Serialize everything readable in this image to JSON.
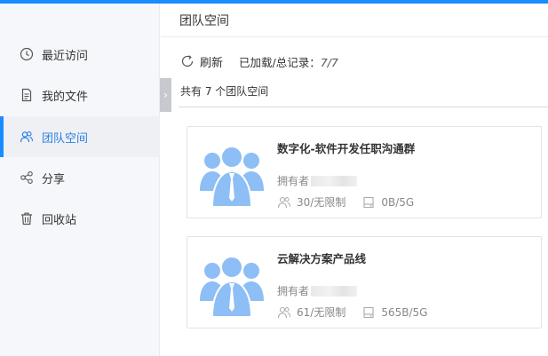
{
  "sidebar": {
    "items": [
      {
        "label": "最近访问",
        "icon": "clock-icon"
      },
      {
        "label": "我的文件",
        "icon": "document-icon"
      },
      {
        "label": "团队空间",
        "icon": "team-icon",
        "active": true
      },
      {
        "label": "分享",
        "icon": "share-icon"
      },
      {
        "label": "回收站",
        "icon": "trash-icon"
      }
    ]
  },
  "header": {
    "title": "团队空间"
  },
  "toolbar": {
    "refresh_label": "刷新",
    "loaded_label": "已加载/总记录：",
    "loaded_count": "7/7"
  },
  "summary": {
    "total_text": "共有 7 个团队空间"
  },
  "spaces": [
    {
      "name": "数字化-软件开发任职沟通群",
      "owner_label": "拥有者",
      "members": "30/无限制",
      "storage": "0B/5G"
    },
    {
      "name": "云解决方案产品线",
      "owner_label": "拥有者",
      "members": "61/无限制",
      "storage": "565B/5G"
    }
  ],
  "colors": {
    "accent": "#1a8cff",
    "avatar": "#8dbef5"
  }
}
